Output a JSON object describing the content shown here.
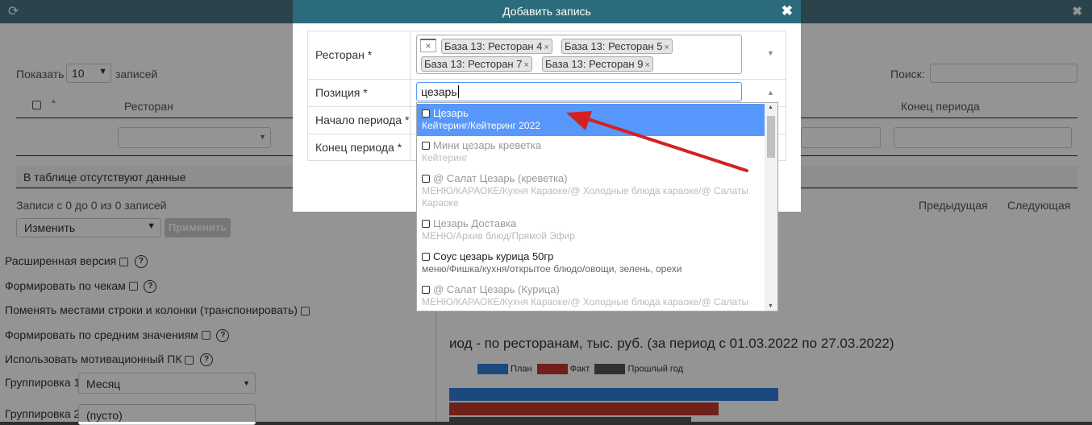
{
  "background": {
    "show_label": "Показать",
    "show_value": "10",
    "records_label": "записей",
    "search_label": "Поиск:",
    "col_restaurant": "Ресторан",
    "col_period_end": "Конец периода",
    "empty_text": "В таблице отсутствуют данные",
    "records_info": "Записи с 0 до 0 из 0 записей",
    "prev": "Предыдущая",
    "next": "Следующая",
    "action_value": "Изменить",
    "apply": "Применить",
    "options": [
      {
        "label": "Расширенная версия",
        "help": true
      },
      {
        "label": "Формировать по чекам",
        "help": true
      },
      {
        "label": "Поменять местами строки и колонки (транспонировать)",
        "help": false
      },
      {
        "label": "Формировать по средним значениям",
        "help": true
      },
      {
        "label": "Использовать мотивационный ПК",
        "help": true
      }
    ],
    "group1_label": "Группировка 1:",
    "group1_value": "Месяц",
    "group2_label": "Группировка 2:",
    "group2_value": "(пусто)",
    "chart_title": "иод - по ресторанам, тыс. руб. (за период с 01.03.2022 по 27.03.2022)",
    "legend": [
      "План",
      "Факт",
      "Прошлый год"
    ],
    "legend_colors": [
      "#2f7ed8",
      "#c0392b",
      "#555555"
    ]
  },
  "modal": {
    "title": "Добавить запись",
    "restaurant_label": "Ресторан *",
    "position_label": "Позиция *",
    "period_start_label": "Начало периода *",
    "period_end_label": "Конец периода *",
    "tags": [
      "База 13: Ресторан 4",
      "База 13: Ресторан 5",
      "База 13: Ресторан 7",
      "База 13: Ресторан 9"
    ],
    "search_value": "цезарь"
  },
  "dropdown": [
    {
      "title": "Цезарь",
      "sub": "Кейтеринг/Кейтеринг 2022",
      "style": "hl"
    },
    {
      "title": "Мини цезарь креветка",
      "sub": "Кейтеринг",
      "style": "dim"
    },
    {
      "title": "@ Салат Цезарь (креветка)",
      "sub": "МЕНЮ/КАРАОКЕ/Кухня Караоке/@ Холодные блюда караоке/@ Салаты Караоке",
      "style": "dim"
    },
    {
      "title": "Цезарь Доставка",
      "sub": "МЕНЮ/Архив блюд/Прямой Эфир",
      "style": "dim"
    },
    {
      "title": "Соус цезарь курица 50гр",
      "sub": "меню/Фишка/кухня/открытое блюдо/овощи, зелень, орехи",
      "style": "dark"
    },
    {
      "title": "@ Салат Цезарь (Курица)",
      "sub": "МЕНЮ/КАРАОКЕ/Кухня Караоке/@ Холодные блюда караоке/@ Салаты Караоке",
      "style": "dim"
    }
  ],
  "colors": {
    "header": "#2b6b7b",
    "highlight": "#5897fb",
    "arrow": "#d42020"
  }
}
